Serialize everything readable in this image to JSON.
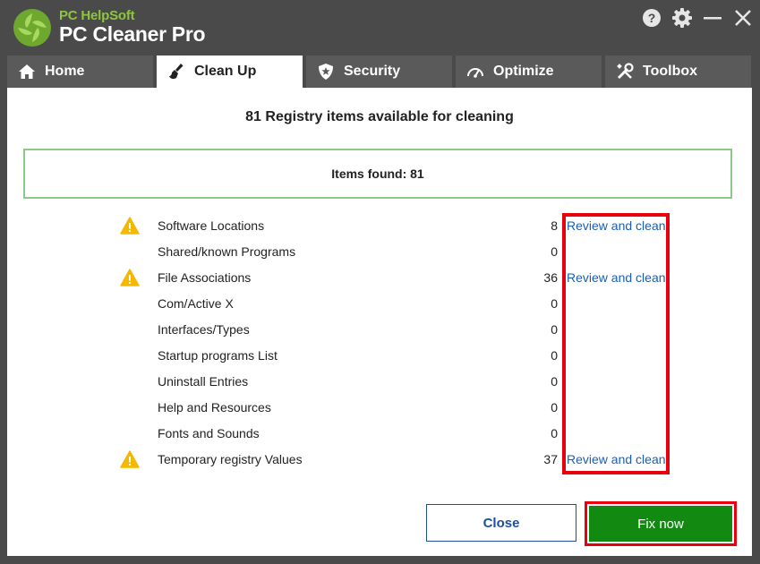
{
  "app": {
    "brand_small": "PC HelpSoft",
    "brand_big": "PC Cleaner Pro"
  },
  "window_controls": [
    "help-icon",
    "gear-icon",
    "minimize-icon",
    "close-icon"
  ],
  "tabs": [
    {
      "label": "Home",
      "icon": "home-icon",
      "active": false
    },
    {
      "label": "Clean Up",
      "icon": "broom-icon",
      "active": true
    },
    {
      "label": "Security",
      "icon": "shield-icon",
      "active": false
    },
    {
      "label": "Optimize",
      "icon": "speedometer-icon",
      "active": false
    },
    {
      "label": "Toolbox",
      "icon": "tools-icon",
      "active": false
    }
  ],
  "main": {
    "headline": "81 Registry items available for cleaning",
    "items_found": "Items found: 81"
  },
  "rows": [
    {
      "label": "Software Locations",
      "count": "8",
      "warn": true,
      "action": "Review and clean"
    },
    {
      "label": "Shared/known Programs",
      "count": "0",
      "warn": false,
      "action": ""
    },
    {
      "label": "File Associations",
      "count": "36",
      "warn": true,
      "action": "Review and clean"
    },
    {
      "label": "Com/Active X",
      "count": "0",
      "warn": false,
      "action": ""
    },
    {
      "label": "Interfaces/Types",
      "count": "0",
      "warn": false,
      "action": ""
    },
    {
      "label": "Startup programs List",
      "count": "0",
      "warn": false,
      "action": ""
    },
    {
      "label": "Uninstall Entries",
      "count": "0",
      "warn": false,
      "action": ""
    },
    {
      "label": "Help and Resources",
      "count": "0",
      "warn": false,
      "action": ""
    },
    {
      "label": "Fonts and Sounds",
      "count": "0",
      "warn": false,
      "action": ""
    },
    {
      "label": "Temporary registry Values",
      "count": "37",
      "warn": true,
      "action": "Review and clean"
    }
  ],
  "buttons": {
    "close": "Close",
    "fix": "Fix now"
  },
  "colors": {
    "accent_green": "#128a12",
    "link_blue": "#1a5fb4",
    "highlight_red": "#e8000d",
    "warning_yellow": "#f5b800"
  }
}
